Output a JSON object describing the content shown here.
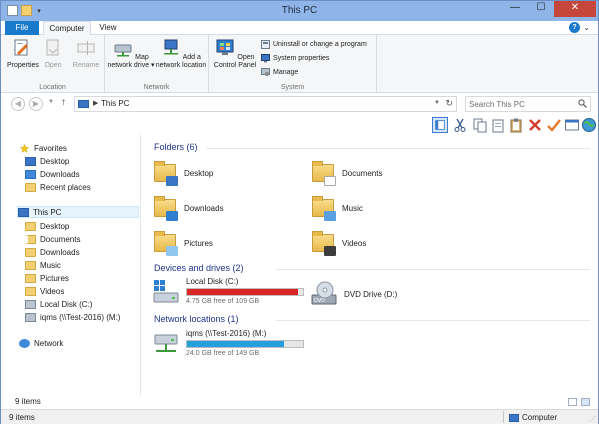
{
  "window": {
    "title": "This PC",
    "controls": {
      "minimize": "—",
      "maximize": "☐",
      "close": "✕"
    },
    "help": "?",
    "ribbon_toggle": "⌄"
  },
  "ribbon_tabs": [
    "File",
    "Computer",
    "View"
  ],
  "ribbon": {
    "location_group": {
      "label": "Location",
      "buttons": [
        "Properties",
        "Open",
        "Rename"
      ]
    },
    "network_group": {
      "label": "Network",
      "buttons": [
        "Map network drive ▾",
        "Add a network location"
      ]
    },
    "system_group": {
      "label": "System",
      "open_control_panel": "Open Control Panel",
      "small_buttons": [
        "Uninstall or change a program",
        "System properties",
        "Manage"
      ]
    }
  },
  "address": {
    "path": "This PC",
    "separator": "▶",
    "back": "◀",
    "forward": "▶",
    "up": "↑",
    "dropdown": "▼",
    "refresh": "↻"
  },
  "search": {
    "placeholder": "Search This PC"
  },
  "toolbar_icons": [
    "layout-icon",
    "cut-icon",
    "copy-icon",
    "paste-icon",
    "clipboard-icon",
    "delete-icon",
    "check-icon",
    "window-icon",
    "globe-icon"
  ],
  "nav": {
    "favorites": "Favorites",
    "favorites_items": [
      "Desktop",
      "Downloads",
      "Recent places"
    ],
    "this_pc": "This PC",
    "pc_items": [
      "Desktop",
      "Documents",
      "Downloads",
      "Music",
      "Pictures",
      "Videos",
      "Local Disk (C:)",
      "iqms (\\\\Test-2016) (M:)"
    ],
    "network": "Network"
  },
  "folders": {
    "header": "Folders (6)",
    "items": [
      "Desktop",
      "Documents",
      "Downloads",
      "Music",
      "Pictures",
      "Videos"
    ]
  },
  "devices": {
    "header": "Devices and drives (2)",
    "local_disk": {
      "name": "Local Disk (C:)",
      "free": "4.75 GB free of 109 GB",
      "used_fraction": 0.956,
      "bar_color": "#da2626"
    },
    "dvd": {
      "name": "DVD Drive (D:)"
    }
  },
  "network_locations": {
    "header": "Network locations (1)",
    "item": {
      "name": "iqms (\\\\Test-2016) (M:)",
      "free": "24.0 GB free of 149 GB",
      "used_fraction": 0.839,
      "bar_color": "#26a0da"
    }
  },
  "status": {
    "item_count": "9 items",
    "item_count_bottom": "9 items",
    "computer": "Computer"
  }
}
